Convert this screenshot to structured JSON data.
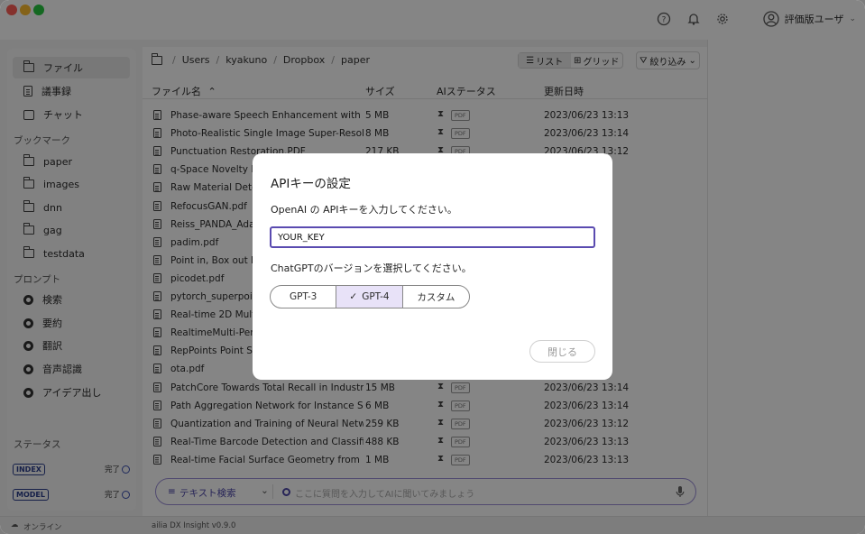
{
  "header": {
    "user_name": "評価版ユーザ",
    "colors": {
      "close": "#ff5f57",
      "minimize": "#febc2e",
      "maximize": "#28c840"
    }
  },
  "sidebar": {
    "primary": [
      {
        "label": "ファイル",
        "icon": "folder-icon",
        "active": true
      },
      {
        "label": "議事録",
        "icon": "document-icon"
      },
      {
        "label": "チャット",
        "icon": "chat-icon"
      }
    ],
    "bookmarks_title": "ブックマーク",
    "bookmarks": [
      "paper",
      "images",
      "dnn",
      "gag",
      "testdata"
    ],
    "prompts_title": "プロンプト",
    "prompts": [
      "検索",
      "要約",
      "翻訳",
      "音声認識",
      "アイデア出し"
    ],
    "status_title": "ステータス",
    "status": [
      {
        "badge": "INDEX",
        "state": "完了"
      },
      {
        "badge": "MODEL",
        "state": "完了"
      }
    ]
  },
  "breadcrumb": {
    "parts": [
      "Users",
      "kyakuno",
      "Dropbox",
      "paper"
    ]
  },
  "toolbar": {
    "list_label": "リスト",
    "grid_label": "グリッド",
    "filter_label": "絞り込み"
  },
  "table": {
    "headers": {
      "name": "ファイル名",
      "size": "サイズ",
      "ai_status": "AIステータス",
      "updated": "更新日時"
    },
    "pdf_badge": "PDF",
    "rows": [
      {
        "name": "Phase-aware Speech Enhancement with De",
        "size": "5 MB",
        "updated": "2023/06/23 13:13"
      },
      {
        "name": "Photo-Realistic Single Image Super-Resolut",
        "size": "8 MB",
        "updated": "2023/06/23 13:14"
      },
      {
        "name": "Punctuation Restoration.PDF",
        "size": "217 KB",
        "updated": "2023/06/23 13:12"
      },
      {
        "name": "q-Space Novelty De",
        "size": "",
        "updated": "3"
      },
      {
        "name": "Raw Material Detec",
        "size": "",
        "updated": "4"
      },
      {
        "name": "RefocusGAN.pdf",
        "size": "",
        "updated": "3"
      },
      {
        "name": "Reiss_PANDA_Adap",
        "size": "",
        "updated": "3"
      },
      {
        "name": "padim.pdf",
        "size": "",
        "updated": "37"
      },
      {
        "name": "Point in, Box out Be",
        "size": "",
        "updated": "3"
      },
      {
        "name": "picodet.pdf",
        "size": "",
        "updated": "3"
      },
      {
        "name": "pytorch_superpoint",
        "size": "",
        "updated": "4"
      },
      {
        "name": "Real-time 2D Multi-",
        "size": "",
        "updated": "2"
      },
      {
        "name": "RealtimeMulti-Pers",
        "size": "",
        "updated": "4"
      },
      {
        "name": "RepPoints Point Se",
        "size": "",
        "updated": "4"
      },
      {
        "name": "ota.pdf",
        "size": "",
        "updated": "4"
      },
      {
        "name": "PatchCore Towards Total Recall in Industrial...",
        "size": "15 MB",
        "updated": "2023/06/23 13:14"
      },
      {
        "name": "Path Aggregation Network for Instance Seg...",
        "size": "6 MB",
        "updated": "2023/06/23 13:14"
      },
      {
        "name": "Quantization and Training of Neural Networ...",
        "size": "259 KB",
        "updated": "2023/06/23 13:12"
      },
      {
        "name": "Real-Time Barcode Detection and Classifica...",
        "size": "488 KB",
        "updated": "2023/06/23 13:13"
      },
      {
        "name": "Real-time Facial Surface Geometry from Mo...",
        "size": "1 MB",
        "updated": "2023/06/23 13:13"
      }
    ]
  },
  "search": {
    "mode_label": "テキスト検索",
    "placeholder": "ここに質問を入力してAIに聞いてみましょう"
  },
  "footer": {
    "status": "オンライン",
    "version": "ailia DX Insight v0.9.0"
  },
  "modal": {
    "title": "APIキーの設定",
    "key_label": "OpenAI の APIキーを入力してください。",
    "key_value": "YOUR_KEY",
    "version_label": "ChatGPTのバージョンを選択してください。",
    "versions": [
      "GPT-3",
      "GPT-4",
      "カスタム"
    ],
    "selected_version": "GPT-4",
    "close_label": "閉じる",
    "accent_color": "#5a4bb0"
  }
}
